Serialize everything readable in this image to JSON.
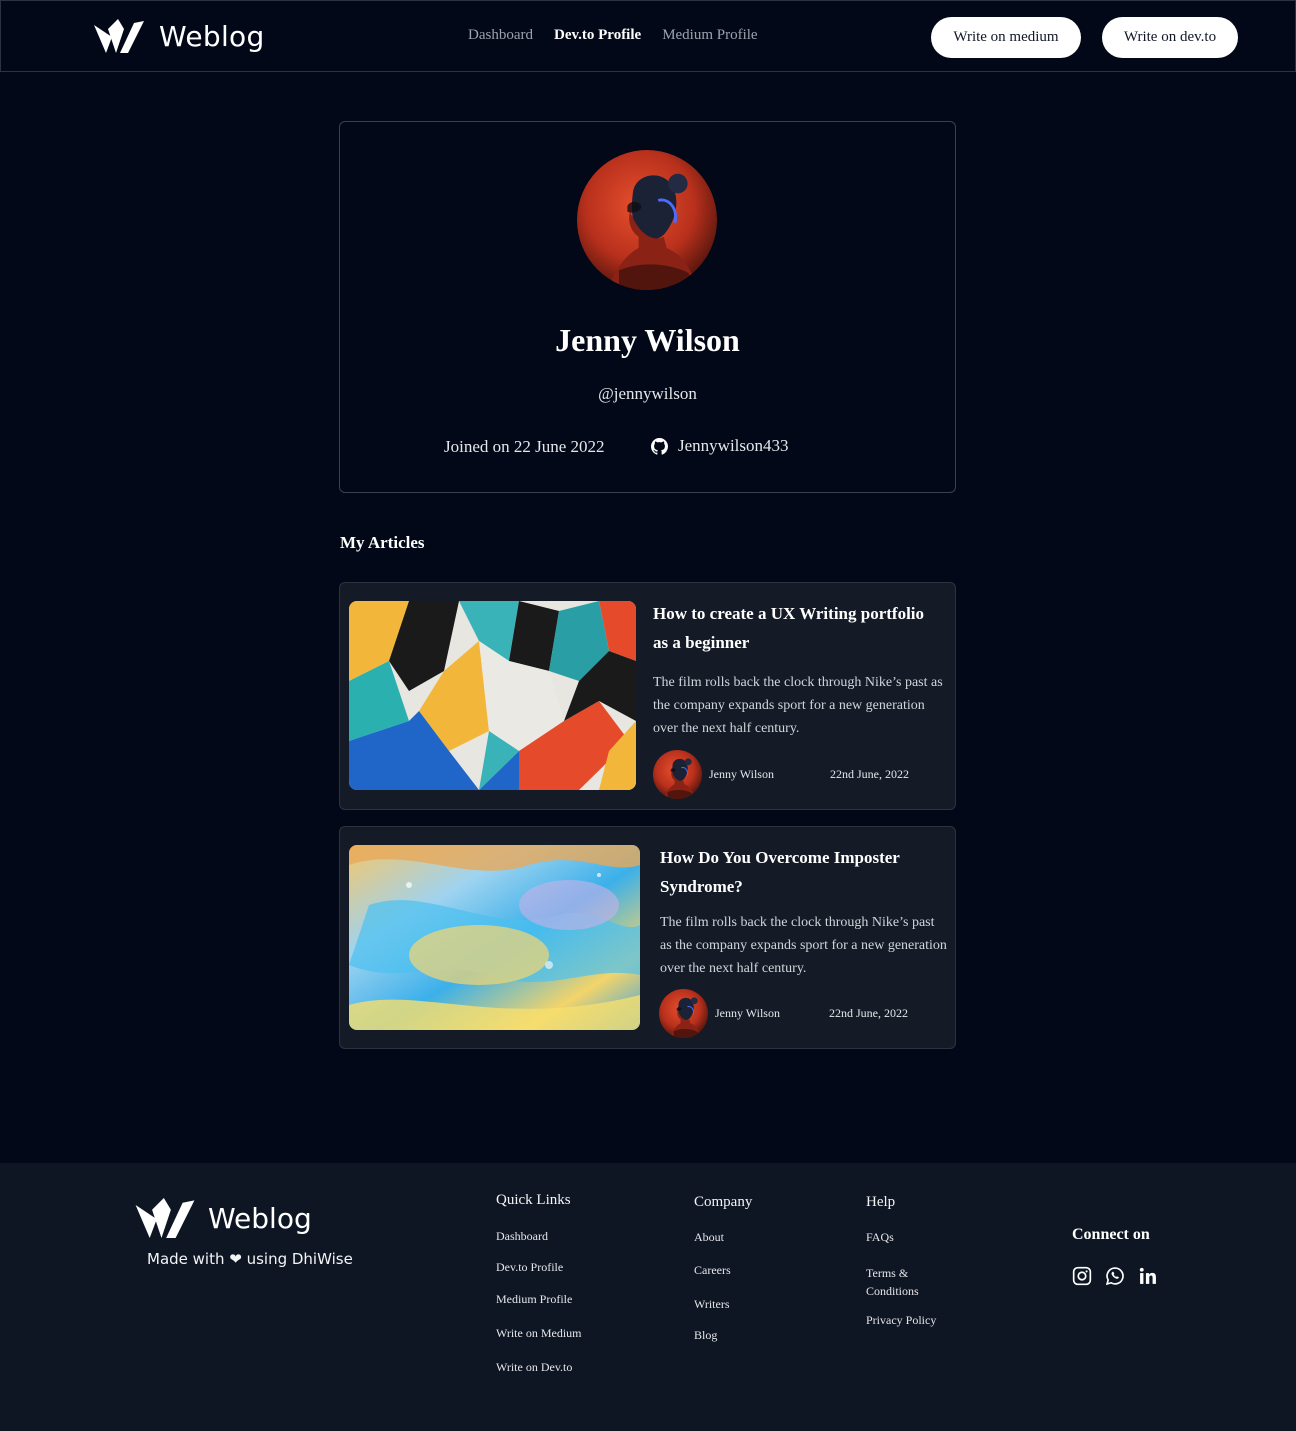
{
  "brand": {
    "name": "Weblog"
  },
  "nav": {
    "items": [
      {
        "label": "Dashboard",
        "active": false
      },
      {
        "label": "Dev.to Profile",
        "active": true
      },
      {
        "label": "Medium Profile",
        "active": false
      }
    ],
    "write_medium": "Write on medium",
    "write_devto": "Write on dev.to"
  },
  "profile": {
    "name": "Jenny Wilson",
    "handle": "@jennywilson",
    "joined": "Joined on 22 June 2022",
    "github": "Jennywilson433"
  },
  "articles_section": {
    "title": "My Articles"
  },
  "articles": [
    {
      "title": "How to create a UX Writing portfolio as a beginner",
      "description": "The film rolls back the clock through Nike’s past as the company expands sport for a new generation over the next half century.",
      "author": "Jenny Wilson",
      "date": "22nd June, 2022"
    },
    {
      "title": "How Do You Overcome Imposter Syndrome?",
      "description": "The film rolls back the clock through Nike’s past as the company expands sport for a new generation over the next half century.",
      "author": "Jenny Wilson",
      "date": "22nd June, 2022"
    }
  ],
  "footer": {
    "tagline": "Made with ❤ using DhiWise",
    "quick_links": {
      "title": "Quick Links",
      "items": [
        "Dashboard",
        "Dev.to Profile",
        "Medium Profile",
        "Write on Medium",
        "Write on Dev.to"
      ]
    },
    "company": {
      "title": "Company",
      "items": [
        "About",
        "Careers",
        "Writers",
        "Blog"
      ]
    },
    "help": {
      "title": "Help",
      "items": [
        "FAQs",
        "Terms & Conditions",
        "Privacy Policy"
      ]
    },
    "connect": {
      "title": "Connect on",
      "icons": [
        "instagram-icon",
        "whatsapp-icon",
        "linkedin-icon"
      ]
    }
  },
  "colors": {
    "background": "#020817",
    "card": "#151b26",
    "footer": "#0f1623",
    "button": "#ffffff"
  }
}
